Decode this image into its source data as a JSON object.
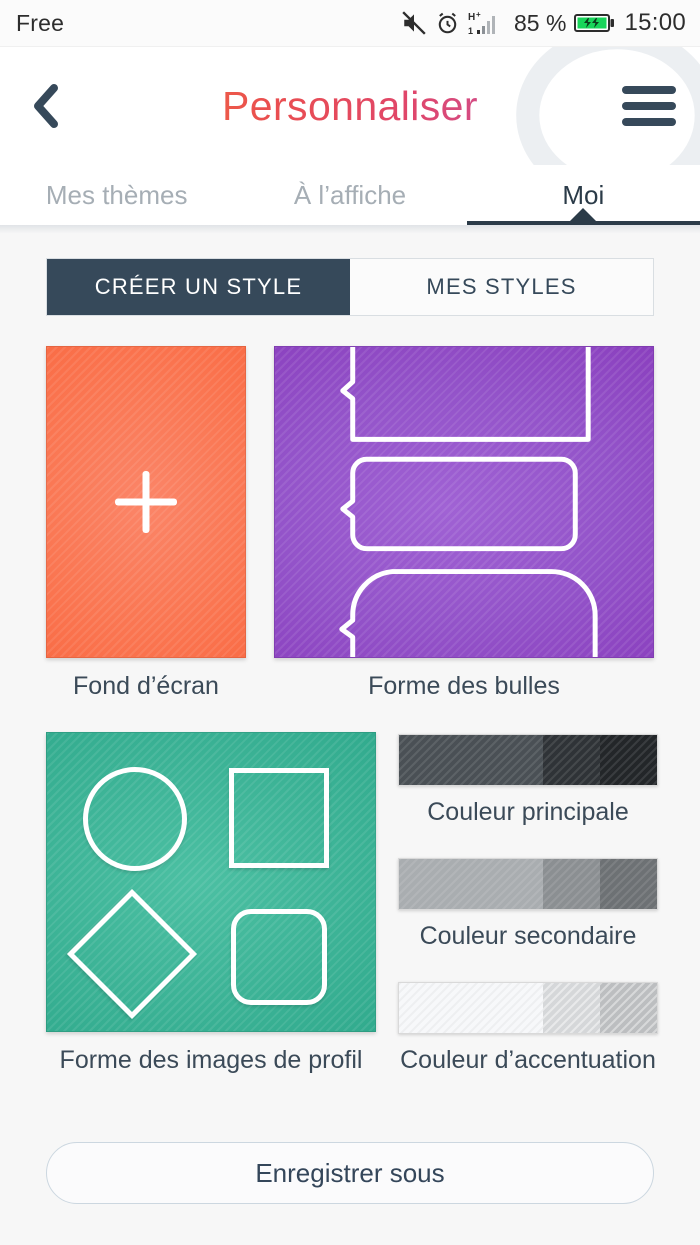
{
  "statusbar": {
    "carrier": "Free",
    "battery_percent": "85 %",
    "time": "15:00",
    "icons": [
      "mute-icon",
      "alarm-icon",
      "hsplus-signal-icon",
      "battery-charging-icon"
    ]
  },
  "header": {
    "title": "Personnaliser",
    "back_icon": "chevron-left-icon",
    "menu_icon": "hamburger-menu-icon",
    "title_gradient_from": "#f7913c",
    "title_gradient_to": "#8f5bd4"
  },
  "tabs": [
    {
      "label": "Mes thèmes",
      "active": false
    },
    {
      "label": "À l’affiche",
      "active": false
    },
    {
      "label": "Moi",
      "active": true
    }
  ],
  "segmented": {
    "options": [
      {
        "label": "CRÉER UN STYLE",
        "active": true
      },
      {
        "label": "MES STYLES",
        "active": false
      }
    ]
  },
  "cards": {
    "wallpaper": {
      "label": "Fond d’écran",
      "icon": "plus-icon",
      "color": "#f96a43"
    },
    "bubbles": {
      "label": "Forme des bulles",
      "color": "#8a3fbe",
      "shapes": [
        "square-bubble",
        "rounded-bubble",
        "pill-bubble"
      ]
    },
    "profile_shapes": {
      "label": "Forme des images de profil",
      "color": "#2fa98c",
      "shapes": [
        "circle",
        "square",
        "diamond",
        "rounded-square"
      ]
    }
  },
  "colors": {
    "primary": {
      "label": "Couleur principale",
      "segments": [
        "#4a5055",
        "#2f3337",
        "#232629"
      ]
    },
    "secondary": {
      "label": "Couleur secondaire",
      "segments": [
        "#a9adb0",
        "#8b8f92",
        "#6d7174"
      ]
    },
    "accent": {
      "label": "Couleur d’accentuation",
      "segments": [
        "#f7f8fa",
        "#d5d7d9",
        "#bcbec0"
      ]
    }
  },
  "save": {
    "label": "Enregistrer sous"
  }
}
